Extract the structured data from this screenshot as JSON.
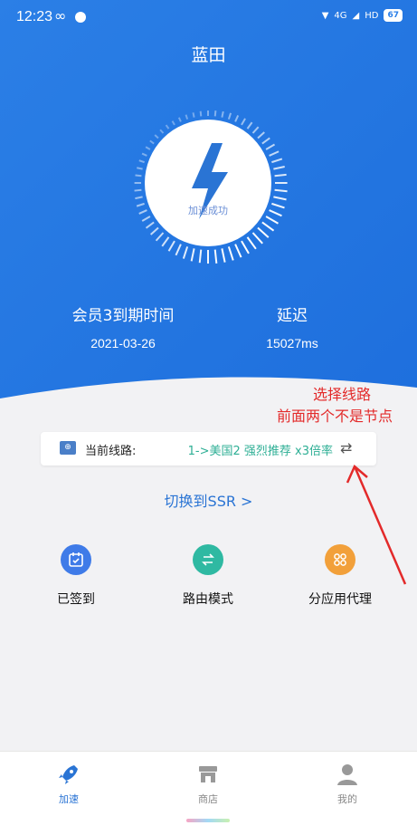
{
  "status": {
    "time": "12:23",
    "network": "4G",
    "battery": "67"
  },
  "title": "蓝田",
  "dial": {
    "label": "加速成功"
  },
  "member": {
    "label": "会员3到期时间",
    "value": "2021-03-26"
  },
  "latency": {
    "label": "延迟",
    "value": "15027ms"
  },
  "annotation": {
    "line1": "选择线路",
    "line2": "前面两个不是节点"
  },
  "current_line": {
    "label": "当前线路:",
    "value": "1->美国2 强烈推荐 x3倍率",
    "flag_icon": "un-flag-icon",
    "switch_icon": "swap-arrows-icon"
  },
  "switch_ssr": "切换到SSR >",
  "features": [
    {
      "label": "已签到",
      "icon": "calendar-check-icon",
      "color": "#3f7be8"
    },
    {
      "label": "路由模式",
      "icon": "route-swap-icon",
      "color": "#2fb9a2"
    },
    {
      "label": "分应用代理",
      "icon": "grid-apps-icon",
      "color": "#f2a03a"
    }
  ],
  "tabs": [
    {
      "label": "加速",
      "icon": "rocket-icon",
      "active": true,
      "color": "#2a74d4"
    },
    {
      "label": "商店",
      "icon": "store-icon",
      "active": false
    },
    {
      "label": "我的",
      "icon": "user-icon",
      "active": false
    }
  ]
}
